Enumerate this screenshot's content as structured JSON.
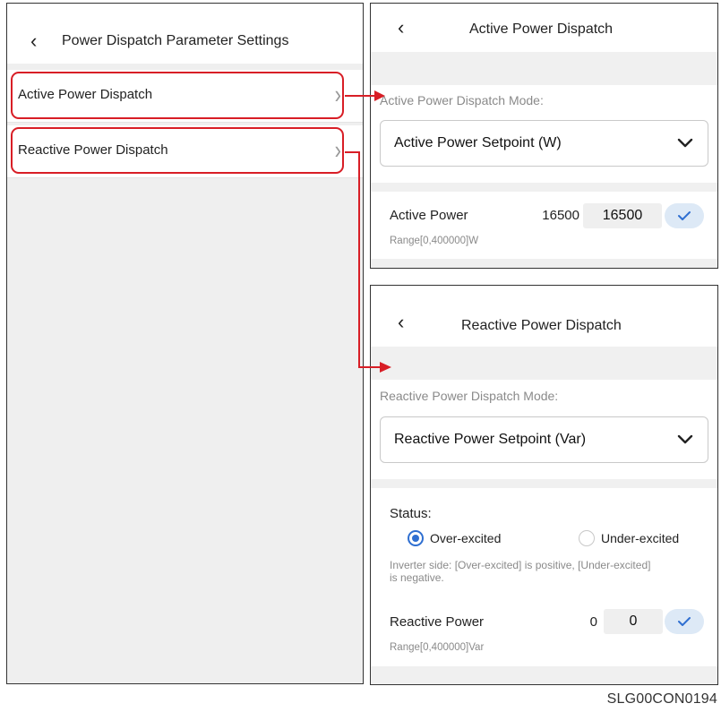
{
  "left_panel": {
    "title": "Power Dispatch Parameter Settings",
    "items": [
      {
        "label": "Active Power Dispatch"
      },
      {
        "label": "Reactive Power Dispatch"
      }
    ]
  },
  "active_panel": {
    "title": "Active Power Dispatch",
    "mode_label": "Active Power Dispatch Mode:",
    "mode_value": "Active Power Setpoint (W)",
    "field_label": "Active Power",
    "current_value": "16500",
    "input_value": "16500",
    "range": "Range[0,400000]W"
  },
  "reactive_panel": {
    "title": "Reactive Power Dispatch",
    "mode_label": "Reactive Power Dispatch Mode:",
    "mode_value": "Reactive Power Setpoint (Var)",
    "status_label": "Status:",
    "options": [
      {
        "label": "Over-excited",
        "selected": true
      },
      {
        "label": "Under-excited",
        "selected": false
      }
    ],
    "note": "Inverter side: [Over-excited] is positive, [Under-excited] is negative.",
    "field_label": "Reactive Power",
    "current_value": "0",
    "input_value": "0",
    "range": "Range[0,400000]Var"
  },
  "figure_code": "SLG00CON0194",
  "colors": {
    "highlight_red": "#d81e26",
    "accent_blue": "#2f6fd1",
    "confirm_bg": "#dde9f6"
  },
  "icons": [
    "chevron-left-icon",
    "chevron-right-icon",
    "chevron-down-icon",
    "check-icon"
  ]
}
